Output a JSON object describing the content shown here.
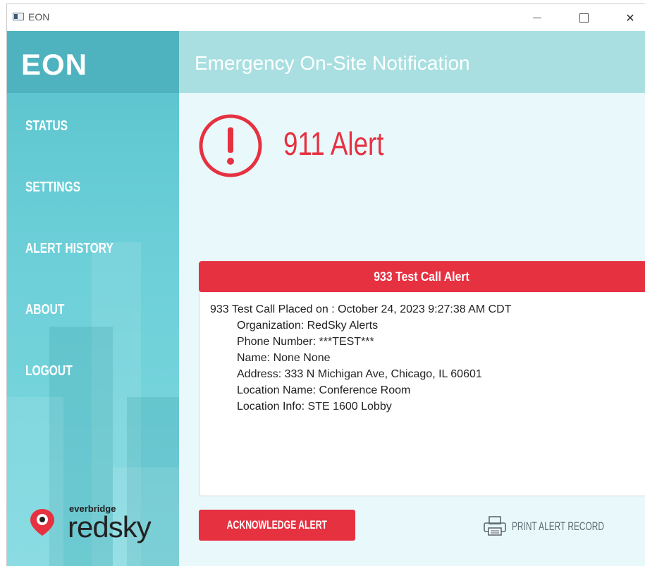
{
  "window": {
    "title": "EON",
    "controls": {
      "minimize": "minimize",
      "maximize": "maximize",
      "close": "✕"
    }
  },
  "sidebar": {
    "logo": "EON",
    "items": [
      {
        "label": "STATUS"
      },
      {
        "label": "SETTINGS"
      },
      {
        "label": "ALERT HISTORY"
      },
      {
        "label": "ABOUT"
      },
      {
        "label": "LOGOUT"
      }
    ],
    "brand": {
      "small": "everbridge",
      "big": "redsky"
    }
  },
  "main": {
    "title": "Emergency On-Site Notification",
    "alert_heading": "911 Alert",
    "panel": {
      "header": "933 Test Call Alert",
      "lines": [
        "933 Test Call Placed on : October 24, 2023 9:27:38 AM CDT",
        "Organization: RedSky Alerts",
        "Phone Number: ***TEST***",
        "Name: None None",
        "Address: 333 N Michigan Ave, Chicago, IL 60601",
        "Location Name: Conference Room",
        "Location Info: STE 1600 Lobby"
      ]
    },
    "acknowledge_label": "ACKNOWLEDGE ALERT",
    "print_label": "PRINT ALERT RECORD"
  },
  "colors": {
    "alert_red": "#e63141",
    "sidebar_teal": "#58c2cc",
    "header_teal": "#a9dfe1",
    "main_bg": "#e9f9fb"
  },
  "icons": {
    "app": "app-window-icon",
    "alert": "exclamation-circle-icon",
    "brand": "location-pin-icon",
    "print": "printer-icon"
  }
}
